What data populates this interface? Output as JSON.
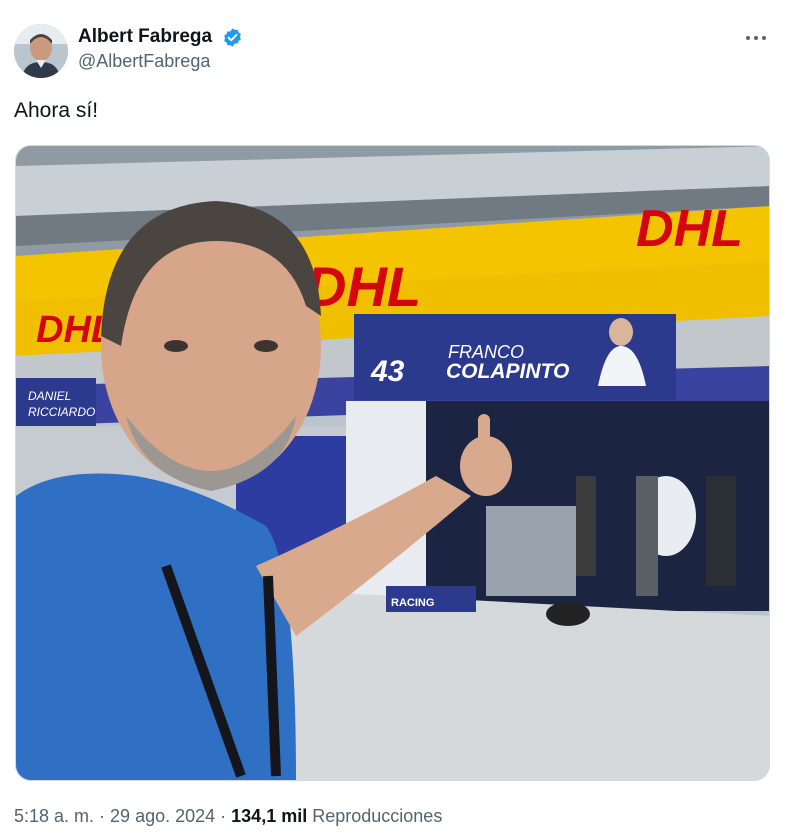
{
  "author": {
    "display_name": "Albert Fabrega",
    "handle": "@AlbertFabrega",
    "verified": true,
    "avatar_icon": "avatar-photo",
    "verified_color": "#1d9bf0"
  },
  "menu": {
    "icon": "more-horizontal-icon"
  },
  "tweet": {
    "text": "Ahora sí!"
  },
  "media": {
    "type": "photo",
    "signage": {
      "sponsor_banner": "DHL",
      "car_number": "43",
      "driver_first": "FRANCO",
      "driver_last": "COLAPINTO",
      "other_garage_first": "DANIEL",
      "other_garage_last": "RICCIARDO",
      "floor_text": "RACING"
    },
    "colors": {
      "dhl_yellow": "#f5c400",
      "dhl_red": "#d40511",
      "team_blue": "#2c3a8e"
    }
  },
  "meta": {
    "time": "5:18 a. m.",
    "separator": " · ",
    "date": "29 ago. 2024",
    "views_count": "134,1 mil",
    "views_label": "Reproducciones"
  }
}
